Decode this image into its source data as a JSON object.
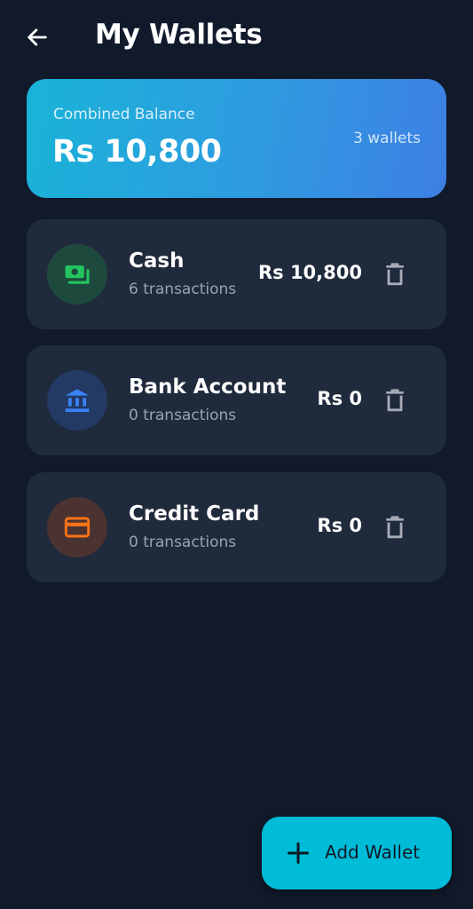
{
  "header": {
    "title": "My Wallets",
    "back_icon": "arrow-left-icon"
  },
  "balance": {
    "label": "Combined Balance",
    "amount": "Rs 10,800",
    "count": "3 wallets",
    "gradient": [
      "#19b3d8",
      "#3d7fe4"
    ]
  },
  "wallets": [
    {
      "name": "Cash",
      "transactions": "6 transactions",
      "amount": "Rs 10,800",
      "icon": "money-icon",
      "icon_color": "#22c55e",
      "icon_bg": "#1e4a3e"
    },
    {
      "name": "Bank Account",
      "transactions": "0 transactions",
      "amount": "Rs 0",
      "icon": "bank-icon",
      "icon_color": "#3b82f6",
      "icon_bg": "#233a64"
    },
    {
      "name": "Credit Card",
      "transactions": "0 transactions",
      "amount": "Rs 0",
      "icon": "credit-card-icon",
      "icon_color": "#f97316",
      "icon_bg": "#4a3331"
    }
  ],
  "fab": {
    "label": "Add Wallet",
    "icon": "plus-icon",
    "color": "#00bcd8"
  }
}
